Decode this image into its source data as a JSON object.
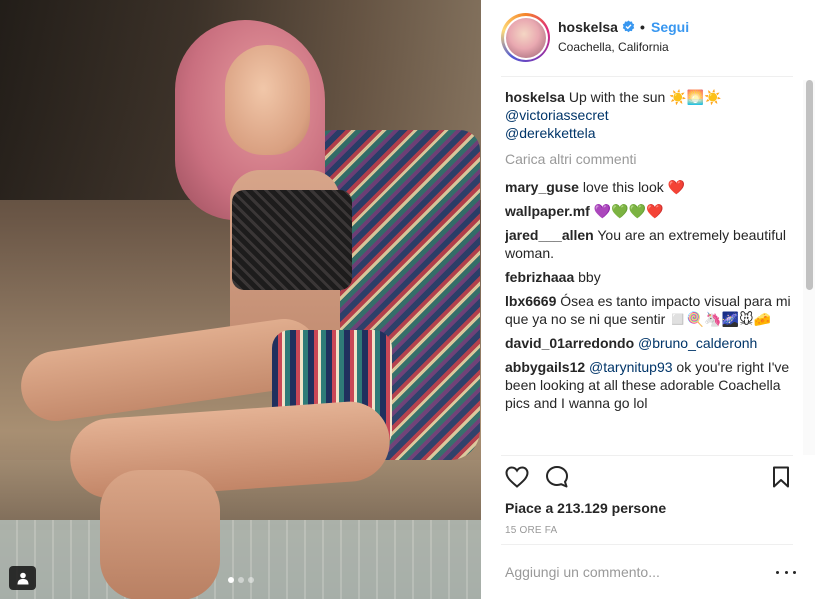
{
  "post": {
    "author": "hoskelsa",
    "verified": true,
    "follow_label": "Segui",
    "location": "Coachella, California",
    "caption": {
      "user": "hoskelsa",
      "text": "Up with the sun ☀️🌅☀️",
      "mentions": [
        "@victoriassecret",
        "@derekkettela"
      ]
    },
    "load_more_label": "Carica altri commenti",
    "comments": [
      {
        "user": "mary_guse",
        "text": "love this look ❤️"
      },
      {
        "user": "wallpaper.mf",
        "text": "💜💚💚❤️"
      },
      {
        "user": "jared___allen",
        "text": "You are an extremely beautiful woman."
      },
      {
        "user": "febrizhaaa",
        "text": "bby"
      },
      {
        "user": "lbx6669",
        "text": "Ósea es tanto impacto visual para mi que ya no se ni que sentir ◻️🍭🦄🌌🐭🧀"
      },
      {
        "user": "david_01arredondo",
        "mention": "@bruno_calderonh",
        "text": ""
      },
      {
        "user": "abbygails12",
        "mention": "@tarynitup93",
        "text": "ok you're right I've been looking at all these adorable Coachella pics and I wanna go lol"
      }
    ],
    "likes_text": "Piace a 213.129 persone",
    "timestamp": "15 ORE FA",
    "comment_placeholder": "Aggiungi un commento...",
    "carousel": {
      "count": 3,
      "active": 0
    }
  },
  "icons": {
    "like": "heart-icon",
    "comment": "speech-bubble-icon",
    "save": "bookmark-icon",
    "more": "more-options-icon",
    "user_tag": "user-tag-icon",
    "verified": "verified-badge-icon"
  },
  "colors": {
    "link": "#3897f0",
    "mention": "#003569",
    "muted": "#999999",
    "text": "#262626"
  }
}
